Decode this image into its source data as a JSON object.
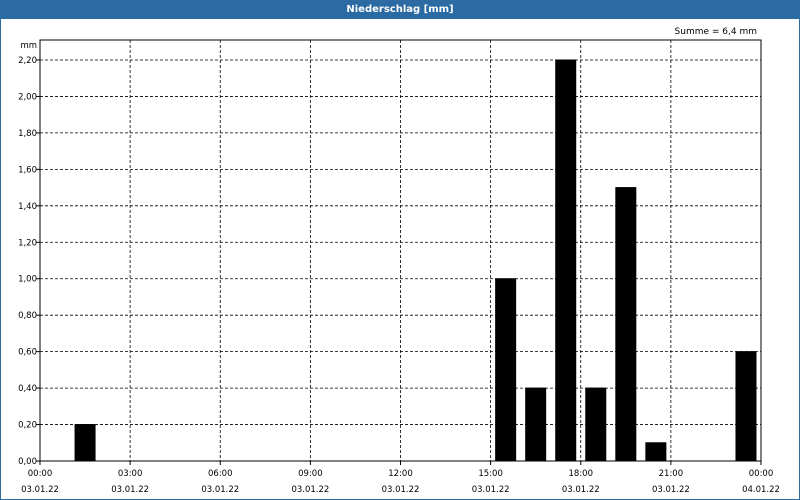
{
  "header": {
    "title": "Niederschlag [mm]"
  },
  "summary": {
    "text": "Summe = 6,4 mm"
  },
  "chart_data": {
    "type": "bar",
    "ylabel": "mm",
    "ylim": [
      0,
      2.3
    ],
    "grid": true,
    "y_ticks": [
      "0,00",
      "0,20",
      "0,40",
      "0,60",
      "0,80",
      "1,00",
      "1,20",
      "1,40",
      "1,60",
      "1,80",
      "2,00",
      "2,20"
    ],
    "y_tick_values": [
      0,
      0.2,
      0.4,
      0.6,
      0.8,
      1.0,
      1.2,
      1.4,
      1.6,
      1.8,
      2.0,
      2.2
    ],
    "x_ticks": [
      {
        "hour": 0,
        "time": "00:00",
        "date": "03.01.22"
      },
      {
        "hour": 3,
        "time": "03:00",
        "date": "03.01.22"
      },
      {
        "hour": 6,
        "time": "06:00",
        "date": "03.01.22"
      },
      {
        "hour": 9,
        "time": "09:00",
        "date": "03.01.22"
      },
      {
        "hour": 12,
        "time": "12:00",
        "date": "03.01.22"
      },
      {
        "hour": 15,
        "time": "15:00",
        "date": "03.01.22"
      },
      {
        "hour": 18,
        "time": "18:00",
        "date": "03.01.22"
      },
      {
        "hour": 21,
        "time": "21:00",
        "date": "03.01.22"
      },
      {
        "hour": 24,
        "time": "00:00",
        "date": "04.01.22"
      }
    ],
    "bars": [
      {
        "start_hour": 1,
        "value": 0.2
      },
      {
        "start_hour": 15,
        "value": 1.0
      },
      {
        "start_hour": 16,
        "value": 0.4
      },
      {
        "start_hour": 17,
        "value": 2.2
      },
      {
        "start_hour": 18,
        "value": 0.4
      },
      {
        "start_hour": 19,
        "value": 1.5
      },
      {
        "start_hour": 20,
        "value": 0.1
      },
      {
        "start_hour": 23,
        "value": 0.6
      }
    ],
    "colors": {
      "bar": "#000000",
      "header": "#2b6aa3"
    }
  }
}
